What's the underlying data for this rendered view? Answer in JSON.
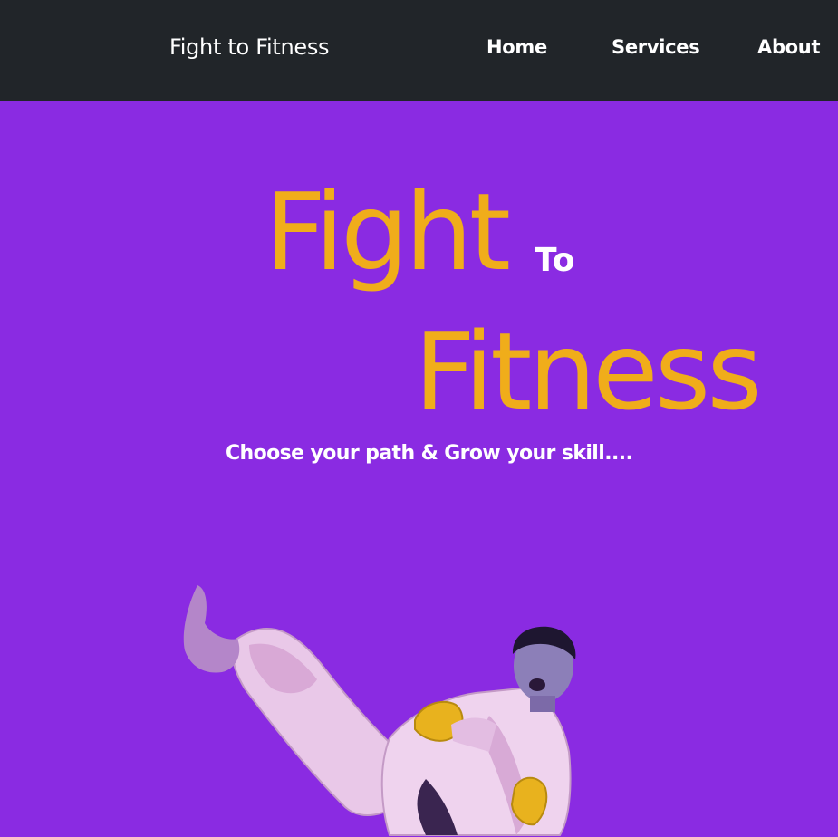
{
  "navbar": {
    "brand": "Fight to Fitness",
    "links": [
      "Home",
      "Services",
      "About"
    ]
  },
  "hero": {
    "title_word_1": "Fight",
    "title_connector": "To",
    "title_word_2": "Fitness",
    "tagline": "Choose your path & Grow your skill...."
  },
  "colors": {
    "navbar_bg": "#212529",
    "hero_bg": "#8a2be2",
    "title_color": "#f0ad1a",
    "text_light": "#ffffff"
  },
  "icons": {
    "hero_image": "karate-kick-fighter-image"
  }
}
